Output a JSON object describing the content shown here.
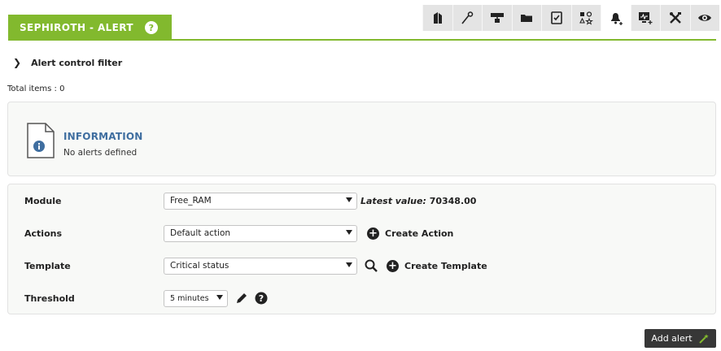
{
  "header": {
    "title": "SEPHIROTH - ALERT",
    "help_icon": "question-circle-icon",
    "tabs": [
      {
        "icon": "building-icon",
        "active": false
      },
      {
        "icon": "wrench-key-icon",
        "active": false
      },
      {
        "icon": "network-icon",
        "active": false
      },
      {
        "icon": "folder-icon",
        "active": false
      },
      {
        "icon": "checklist-icon",
        "active": false
      },
      {
        "icon": "shapes-icon",
        "active": false
      },
      {
        "icon": "bell-plus-icon",
        "active": true
      },
      {
        "icon": "monitor-plus-icon",
        "active": false
      },
      {
        "icon": "tools-icon",
        "active": false
      },
      {
        "icon": "eye-icon",
        "active": false
      }
    ]
  },
  "filter": {
    "label": "Alert control filter"
  },
  "total": "Total items : 0",
  "info": {
    "title": "INFORMATION",
    "message": "No alerts defined"
  },
  "form": {
    "module_label": "Module",
    "module_value": "Free_RAM",
    "latest_label": "Latest value:",
    "latest_value": "70348.00",
    "actions_label": "Actions",
    "actions_value": "Default action",
    "create_action": "Create Action",
    "template_label": "Template",
    "template_value": "Critical status",
    "create_template": "Create Template",
    "threshold_label": "Threshold",
    "threshold_value": "5 minutes"
  },
  "add_button": {
    "label": "Add alert"
  },
  "colors": {
    "accent": "#82b92e",
    "info_title": "#3f6ea0",
    "button_bg": "#373737"
  }
}
